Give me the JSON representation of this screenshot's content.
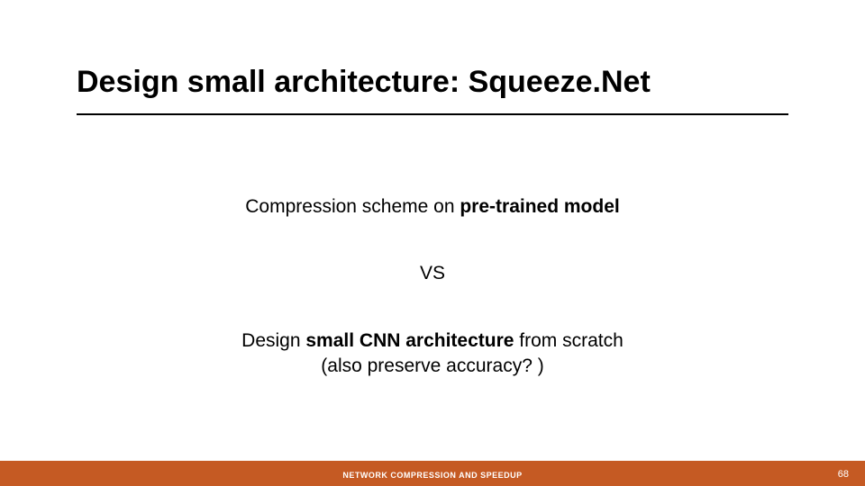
{
  "slide": {
    "title": "Design small architecture: Squeeze.Net",
    "body": {
      "line1_pre": "Compression scheme on ",
      "line1_bold": "pre-trained model",
      "vs": "VS",
      "line3a_pre": "Design ",
      "line3a_bold": "small CNN architecture",
      "line3a_post": " from scratch",
      "line3b": "(also preserve accuracy? )"
    },
    "footer": "NETWORK COMPRESSION AND SPEEDUP",
    "page": "68"
  }
}
